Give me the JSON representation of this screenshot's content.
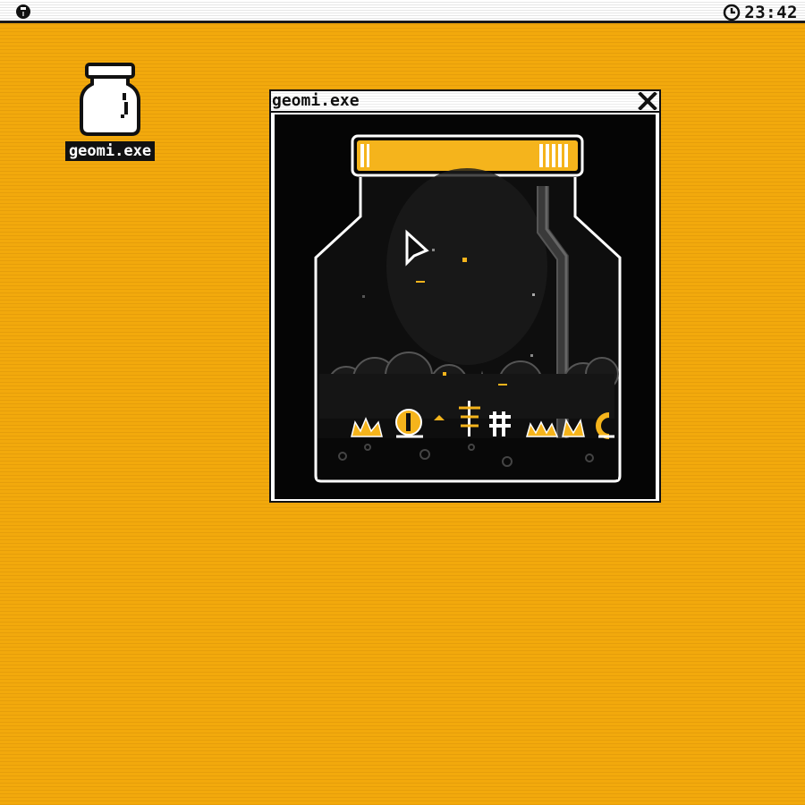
{
  "menubar": {
    "logo_icon": "bug-logo-icon",
    "clock_icon": "clock-icon",
    "time": "23:42"
  },
  "desktop": {
    "icons": [
      {
        "label": "geomi.exe",
        "icon": "jar-icon"
      }
    ]
  },
  "window": {
    "title": "geomi.exe",
    "close_icon": "close-icon",
    "content": "terrarium-jar-scene"
  },
  "colors": {
    "desktop": "#f2a90c",
    "accent": "#f5b41c",
    "window_bg": "#050505",
    "frame": "#111111"
  }
}
